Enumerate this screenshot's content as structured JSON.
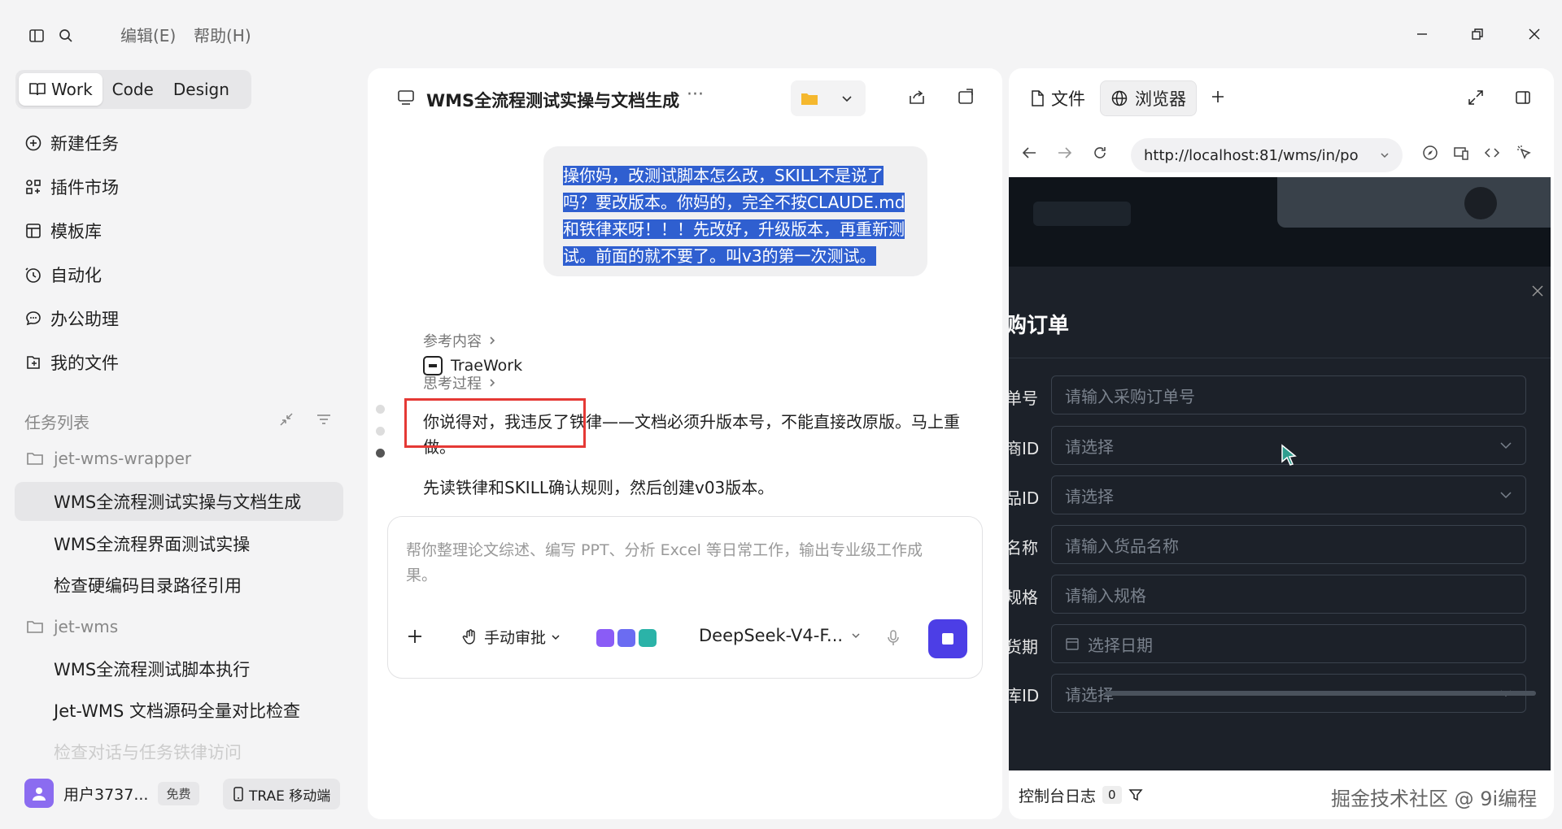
{
  "menu": {
    "edit": "编辑(E)",
    "help": "帮助(H)"
  },
  "sidebar": {
    "modes": [
      "Work",
      "Code",
      "Design"
    ],
    "nav": [
      {
        "label": "新建任务",
        "icon": "plus-circle-icon"
      },
      {
        "label": "插件市场",
        "icon": "grid-icon"
      },
      {
        "label": "模板库",
        "icon": "template-icon"
      },
      {
        "label": "自动化",
        "icon": "clock-icon"
      },
      {
        "label": "办公助理",
        "icon": "chat-icon"
      },
      {
        "label": "我的文件",
        "icon": "files-icon"
      }
    ],
    "task_list_label": "任务列表",
    "folder1": "jet-wms-wrapper",
    "tasks1": [
      "WMS全流程测试实操与文档生成",
      "WMS全流程界面测试实操",
      "检查硬编码目录路径引用"
    ],
    "folder2": "jet-wms",
    "tasks2": [
      "WMS全流程测试脚本执行",
      "Jet-WMS 文档源码全量对比检查",
      "检查对话与任务铁律访问"
    ],
    "user_name": "用户3737...",
    "plan_badge": "免费",
    "mobile_label": "TRAE 移动端"
  },
  "chat": {
    "title": "WMS全流程测试实操与文档生成",
    "more": "···",
    "user_message": "操你妈，改测试脚本怎么改，SKILL不是说了吗？要改版本。你妈的，完全不按CLAUDE.md和铁律来呀！！！先改好，升级版本，再重新测试。前面的就不要了。叫v3的第一次测试。",
    "agent_name": "TraeWork",
    "ref_label": "参考内容",
    "think_label": "思考过程",
    "reply_line1": "你说得对，我违反了铁律——文档必须升版本号，不能直接改原版。马上重做。",
    "reply_line2": "先读铁律和SKILL确认规则，然后创建v03版本。",
    "composer_placeholder": "帮你整理论文综述、编写 PPT、分析 Excel 等日常工作，输出专业级工作成果。",
    "approve_label": "手动审批",
    "model_label": "DeepSeek-V4-F..."
  },
  "browser": {
    "tab_files": "文件",
    "tab_browser": "浏览器",
    "url": "http://localhost:81/wms/in/po",
    "modal_title": "购订单",
    "fields": [
      {
        "label": "单号",
        "placeholder": "请输入采购订单号",
        "type": "text"
      },
      {
        "label": "商ID",
        "placeholder": "请选择",
        "type": "select"
      },
      {
        "label": "品ID",
        "placeholder": "请选择",
        "type": "select"
      },
      {
        "label": "名称",
        "placeholder": "请输入货品名称",
        "type": "text"
      },
      {
        "label": "规格",
        "placeholder": "请输入规格",
        "type": "text"
      },
      {
        "label": "货期",
        "placeholder": "选择日期",
        "type": "date"
      },
      {
        "label": "库ID",
        "placeholder": "请选择",
        "type": "select"
      }
    ],
    "console_label": "控制台日志",
    "console_count": "0"
  },
  "watermark": "掘金技术社区 @ 9i编程",
  "colors": {
    "accent": "#4c3ee6",
    "selection": "#2f5fd0",
    "highlight_box": "#e53935"
  }
}
